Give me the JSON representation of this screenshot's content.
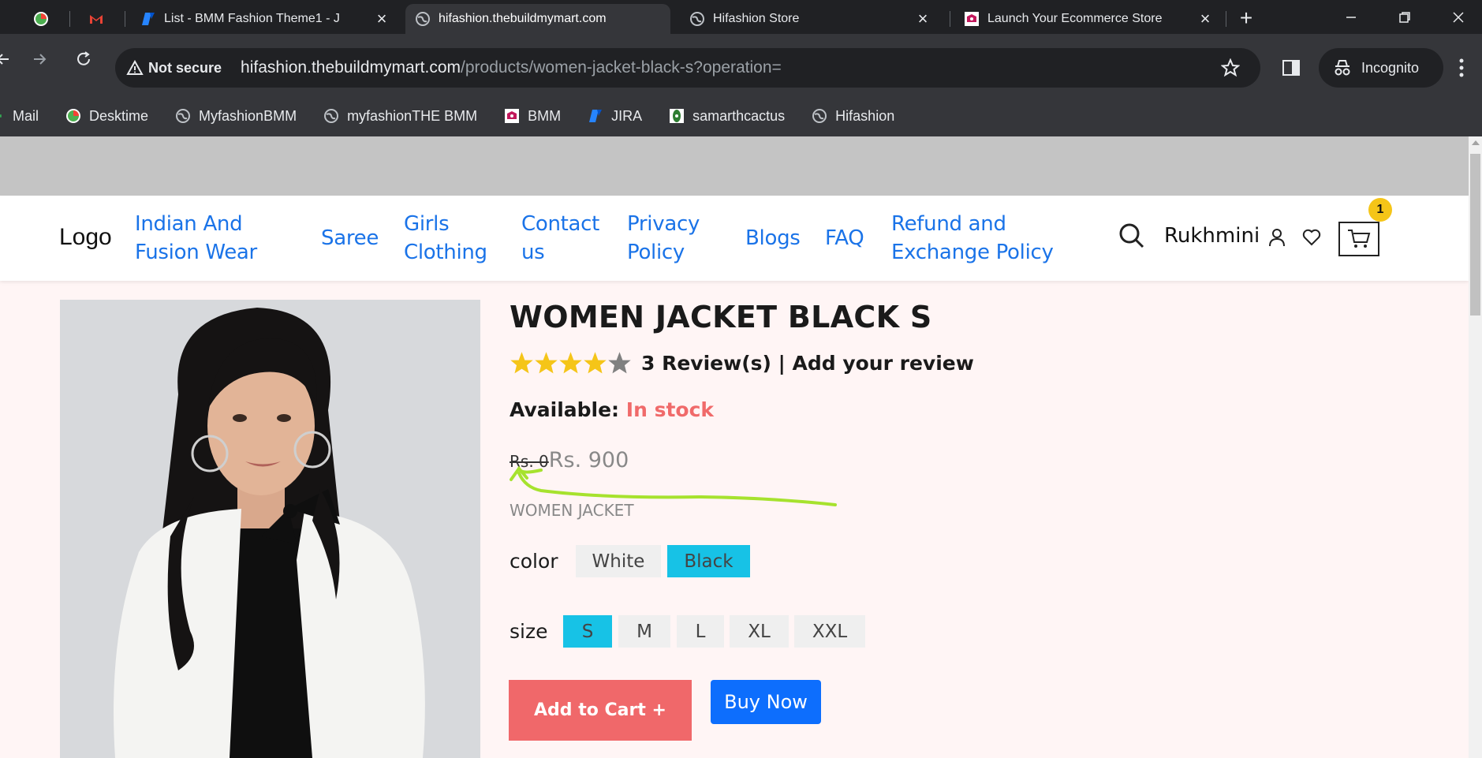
{
  "browser": {
    "tabs": [
      {
        "title": "List - BMM Fashion Theme1 - J",
        "icon": "jira-icon"
      },
      {
        "title": "hifashion.thebuildmymart.com",
        "icon": "globe-icon",
        "active": true
      },
      {
        "title": "Hifashion Store",
        "icon": "globe-icon"
      },
      {
        "title": "Launch Your Ecommerce Store",
        "icon": "bmm-icon"
      }
    ],
    "new_tab_label": "+",
    "close_label": "×",
    "address": {
      "security": "Not secure",
      "host": "hifashion.thebuildmymart.com",
      "path": "/products/women-jacket-black-s?operation="
    },
    "profile_label": "Incognito",
    "bookmarks": [
      "Mail",
      "Desktime",
      "MyfashionBMM",
      "myfashionTHE BMM",
      "BMM",
      "JIRA",
      "samarthcactus",
      "Hifashion"
    ]
  },
  "site": {
    "logo": "Logo",
    "nav": [
      {
        "line1": "Indian And",
        "line2": "Fusion Wear"
      },
      {
        "line1": "Saree",
        "line2": ""
      },
      {
        "line1": "Girls",
        "line2": "Clothing"
      },
      {
        "line1": "Contact",
        "line2": "us"
      },
      {
        "line1": "Privacy",
        "line2": "Policy"
      },
      {
        "line1": "Blogs",
        "line2": ""
      },
      {
        "line1": "FAQ",
        "line2": ""
      },
      {
        "line1": "Refund and",
        "line2": "Exchange Policy"
      }
    ],
    "user_name": "Rukhmini",
    "cart_count": "1"
  },
  "product": {
    "name": "WOMEN JACKET BLACK S",
    "rating": 4,
    "rating_max": 5,
    "reviews_text": "3 Review(s) | Add your review",
    "available_label": "Available:",
    "stock_status": "In stock",
    "old_price": "Rs. 0",
    "price": "Rs. 900",
    "subtitle": "WOMEN JACKET",
    "color_label": "color",
    "colors": [
      "White",
      "Black"
    ],
    "selected_color": "Black",
    "size_label": "size",
    "sizes": [
      "S",
      "M",
      "L",
      "XL",
      "XXL"
    ],
    "selected_size": "S",
    "add_to_cart": "Add to Cart +",
    "buy_now": "Buy Now"
  },
  "colors": {
    "link_blue": "#1a73e8",
    "stock_red": "#f06a6a",
    "chip_selected": "#17c2e6",
    "cart_button": "#f0686a",
    "buy_button": "#0d6efd",
    "annotation": "#a6e22e",
    "star": "#f5c518"
  }
}
